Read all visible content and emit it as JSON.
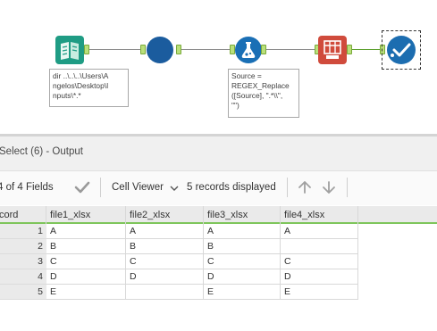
{
  "workflow": {
    "annotations": {
      "input": [
        "dir ..\\..\\..\\Users\\A",
        "ngelos\\Desktop\\I",
        "nputs\\*.*"
      ],
      "formula": [
        "Source =",
        "REGEX_Replace",
        "([Source], \".*\\\\\",",
        "\"\")"
      ]
    }
  },
  "results": {
    "title": "Select (6) - Output",
    "fields_label": "4 of 4 Fields",
    "cell_viewer_label": "Cell Viewer",
    "records_label": "5 records displayed",
    "record_header": "cord",
    "columns": [
      "file1_xlsx",
      "file2_xlsx",
      "file3_xlsx",
      "file4_xlsx"
    ],
    "rows": [
      {
        "num": "1",
        "cells": [
          "A",
          "A",
          "A",
          "A"
        ]
      },
      {
        "num": "2",
        "cells": [
          "B",
          "B",
          "B",
          ""
        ]
      },
      {
        "num": "3",
        "cells": [
          "C",
          "C",
          "C",
          "C"
        ]
      },
      {
        "num": "4",
        "cells": [
          "D",
          "D",
          "D",
          "D"
        ]
      },
      {
        "num": "5",
        "cells": [
          "E",
          "",
          "E",
          "E"
        ]
      }
    ]
  },
  "colors": {
    "anchor": "#b9e07a",
    "header_underline": "#7ec55b",
    "input_tool": "#1f9c84",
    "blue_tool": "#1b5c9e",
    "formula_tool": "#1a6fb5",
    "red_tool": "#d04b3c",
    "browse_tool": "#1c6db0"
  },
  "icons": {
    "input": "book-icon",
    "select": "circle-icon",
    "formula": "flask-icon",
    "transform": "grid-transform-icon",
    "browse": "checkmark-icon",
    "checkmark": "checkmark-icon",
    "up": "arrow-up-icon",
    "down": "arrow-down-icon"
  }
}
